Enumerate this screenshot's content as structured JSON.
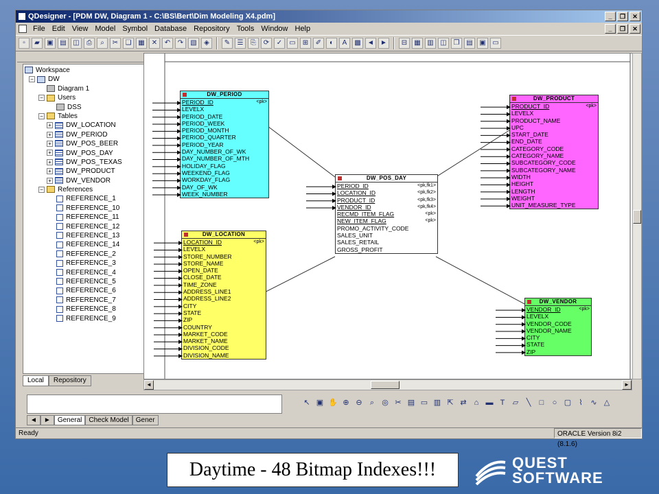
{
  "window": {
    "title": "QDesigner - [PDM DW, Diagram 1 - C:\\BS\\Bert\\Dim Modeling X4.pdm]"
  },
  "menu": [
    "File",
    "Edit",
    "View",
    "Model",
    "Symbol",
    "Database",
    "Repository",
    "Tools",
    "Window",
    "Help"
  ],
  "tree": {
    "workspace": "Workspace",
    "model": "DW",
    "diagram": "Diagram 1",
    "users_folder": "Users",
    "user": "DSS",
    "tables_folder": "Tables",
    "tables": [
      "DW_LOCATION",
      "DW_PERIOD",
      "DW_POS_BEER",
      "DW_POS_DAY",
      "DW_POS_TEXAS",
      "DW_PRODUCT",
      "DW_VENDOR"
    ],
    "references_folder": "References",
    "references": [
      "REFERENCE_1",
      "REFERENCE_10",
      "REFERENCE_11",
      "REFERENCE_12",
      "REFERENCE_13",
      "REFERENCE_14",
      "REFERENCE_2",
      "REFERENCE_3",
      "REFERENCE_4",
      "REFERENCE_5",
      "REFERENCE_6",
      "REFERENCE_7",
      "REFERENCE_8",
      "REFERENCE_9"
    ]
  },
  "browser_tabs": [
    "Local",
    "Repository"
  ],
  "output_tabs": [
    "General",
    "Check Model",
    "Gener"
  ],
  "status": {
    "left": "Ready",
    "right": "ORACLE Version 8i2 (8.1.6)"
  },
  "entities": {
    "period": {
      "name": "DW_PERIOD",
      "rows": [
        {
          "label": "PERIOD_ID",
          "tag": "<pk>",
          "key": true
        },
        {
          "label": "LEVELX"
        },
        {
          "label": "PERIOD_DATE"
        },
        {
          "label": "PERIOD_WEEK"
        },
        {
          "label": "PERIOD_MONTH"
        },
        {
          "label": "PERIOD_QUARTER"
        },
        {
          "label": "PERIOD_YEAR"
        },
        {
          "label": "DAY_NUMBER_OF_WK"
        },
        {
          "label": "DAY_NUMBER_OF_MTH"
        },
        {
          "label": "HOLIDAY_FLAG"
        },
        {
          "label": "WEEKEND_FLAG"
        },
        {
          "label": "WORKDAY_FLAG"
        },
        {
          "label": "DAY_OF_WK"
        },
        {
          "label": "WEEK_NUMBER"
        }
      ]
    },
    "location": {
      "name": "DW_LOCATION",
      "rows": [
        {
          "label": "LOCATION_ID",
          "tag": "<pk>",
          "key": true
        },
        {
          "label": "LEVELX"
        },
        {
          "label": "STORE_NUMBER"
        },
        {
          "label": "STORE_NAME"
        },
        {
          "label": "OPEN_DATE"
        },
        {
          "label": "CLOSE_DATE"
        },
        {
          "label": "TIME_ZONE"
        },
        {
          "label": "ADDRESS_LINE1"
        },
        {
          "label": "ADDRESS_LINE2"
        },
        {
          "label": "CITY"
        },
        {
          "label": "STATE"
        },
        {
          "label": "ZIP"
        },
        {
          "label": "COUNTRY"
        },
        {
          "label": "MARKET_CODE"
        },
        {
          "label": "MARKET_NAME"
        },
        {
          "label": "DIVISION_CODE"
        },
        {
          "label": "DIVISION_NAME"
        }
      ]
    },
    "pos": {
      "name": "DW_POS_DAY",
      "rows": [
        {
          "label": "PERIOD_ID",
          "tag": "<pk,fk1>",
          "key": true
        },
        {
          "label": "LOCATION_ID",
          "tag": "<pk,fk2>",
          "key": true
        },
        {
          "label": "PRODUCT_ID",
          "tag": "<pk,fk3>",
          "key": true
        },
        {
          "label": "VENDOR_ID",
          "tag": "<pk,fk4>",
          "key": true
        },
        {
          "label": "RECMD_ITEM_FLAG",
          "tag": "<pk>",
          "key": true
        },
        {
          "label": "NEW_ITEM_FLAG",
          "tag": "<pk>",
          "key": true
        },
        {
          "label": "PROMO_ACTIVITY_CODE"
        },
        {
          "label": "SALES_UNIT"
        },
        {
          "label": "SALES_RETAIL"
        },
        {
          "label": "GROSS_PROFIT"
        }
      ]
    },
    "product": {
      "name": "DW_PRODUCT",
      "rows": [
        {
          "label": "PRODUCT_ID",
          "tag": "<pk>",
          "key": true
        },
        {
          "label": "LEVELX"
        },
        {
          "label": "PRODUCT_NAME"
        },
        {
          "label": "UPC"
        },
        {
          "label": "START_DATE"
        },
        {
          "label": "END_DATE"
        },
        {
          "label": "CATEGORY_CODE"
        },
        {
          "label": "CATEGORY_NAME"
        },
        {
          "label": "SUBCATEGORY_CODE"
        },
        {
          "label": "SUBCATEGORY_NAME"
        },
        {
          "label": "WIDTH"
        },
        {
          "label": "HEIGHT"
        },
        {
          "label": "LENGTH"
        },
        {
          "label": "WEIGHT"
        },
        {
          "label": "UNIT_MEASURE_TYPE"
        }
      ]
    },
    "vendor": {
      "name": "DW_VENDOR",
      "rows": [
        {
          "label": "VENDOR_ID",
          "tag": "<pk>",
          "key": true
        },
        {
          "label": "LEVELX"
        },
        {
          "label": "VENDOR_CODE"
        },
        {
          "label": "VENDOR_NAME"
        },
        {
          "label": "CITY"
        },
        {
          "label": "STATE"
        },
        {
          "label": "ZIP"
        }
      ]
    }
  },
  "caption": "Daytime - 48 Bitmap Indexes!!!",
  "logo": {
    "line1": "QUEST",
    "line2": "SOFTWARE"
  },
  "colors": {
    "period": "#66ffff",
    "location": "#ffff66",
    "product": "#ff66ff",
    "vendor": "#66ff66",
    "titlebar": "#0a246a"
  }
}
